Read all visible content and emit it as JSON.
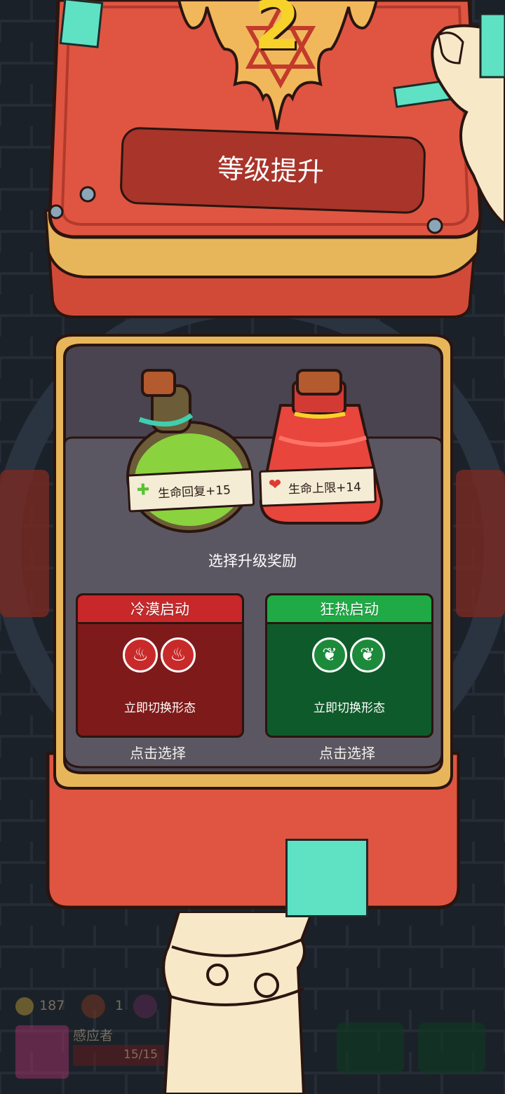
{
  "level": {
    "number": "2",
    "title": "等级提升"
  },
  "rewards": [
    {
      "name": "生命回复+15",
      "icon": "green-cross-icon",
      "potion": "green-potion"
    },
    {
      "name": "生命上限+14",
      "icon": "red-heart-icon",
      "potion": "red-potion"
    }
  ],
  "prompt": "选择升级奖励",
  "cards": [
    {
      "title": "冷漠启动",
      "description": "立即切换形态",
      "select": "点击选择",
      "icon": "flame-icon",
      "color": "#7e1a1a",
      "header_color": "#c8282a"
    },
    {
      "title": "狂热启动",
      "description": "立即切换形态",
      "select": "点击选择",
      "icon": "leaf-icon",
      "color": "#0f5a2a",
      "header_color": "#1faa45"
    }
  ],
  "hud": {
    "gold": "187",
    "relic_count": "1",
    "character_name": "感应者",
    "hp": "15/15"
  },
  "colors": {
    "book_red": "#df5541",
    "book_gold": "#e8b65a",
    "panel": "#4a4450",
    "background": "#1b2129"
  }
}
